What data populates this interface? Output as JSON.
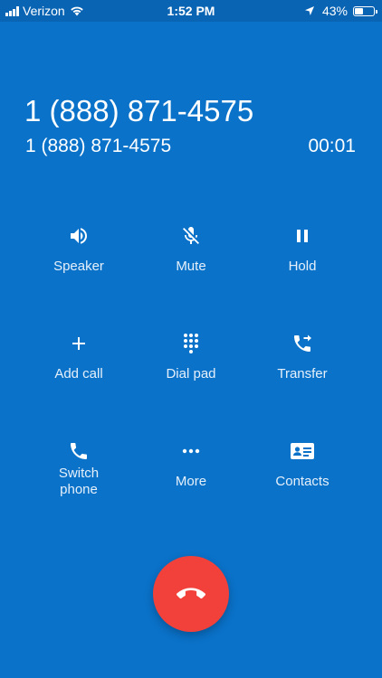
{
  "status_bar": {
    "carrier": "Verizon",
    "time": "1:52 PM",
    "battery_percent": "43%",
    "battery_level": 0.43
  },
  "call": {
    "caller_name": "1 (888) 871-4575",
    "caller_number": "1 (888) 871-4575",
    "duration": "00:01"
  },
  "controls": {
    "speaker": "Speaker",
    "mute": "Mute",
    "hold": "Hold",
    "add_call": "Add call",
    "dial_pad": "Dial pad",
    "transfer": "Transfer",
    "switch_phone_line1": "Switch",
    "switch_phone_line2": "phone",
    "more": "More",
    "contacts": "Contacts"
  },
  "icons": {
    "speaker": "speaker-icon",
    "mute": "mic-off-icon",
    "hold": "pause-icon",
    "add_call": "plus-icon",
    "dial_pad": "dialpad-icon",
    "transfer": "call-transfer-icon",
    "switch_phone": "phone-icon",
    "more": "more-horizontal-icon",
    "contacts": "contact-card-icon",
    "end_call": "call-end-icon"
  },
  "colors": {
    "background": "#0a72c9",
    "status_bar": "#0a64b4",
    "end_call": "#f2413a"
  }
}
